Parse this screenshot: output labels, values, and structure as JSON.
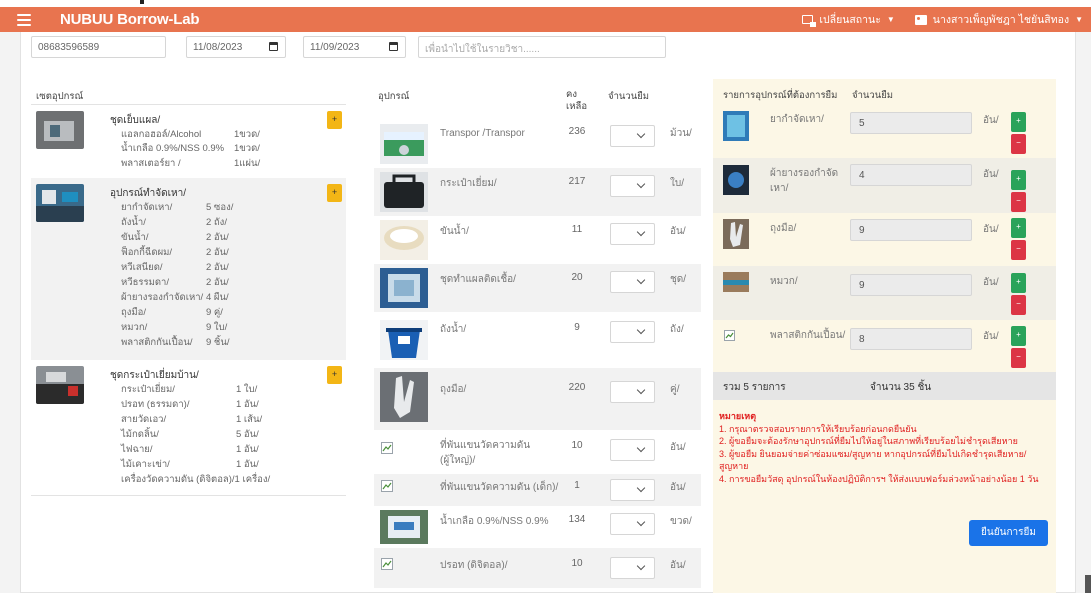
{
  "navbar": {
    "title": "NUBUU Borrow-Lab",
    "change_status_label": "เปลี่ยนสถานะ",
    "user_label": "นางสาวเพ็ญพัชฎา ไชยันสิทอง"
  },
  "filters": {
    "phone": "08683596589",
    "date_from": "11/08/2023",
    "date_to": "11/09/2023",
    "purpose_placeholder": "เพื่อนำไปใช้ในรายวิชา......"
  },
  "sets": {
    "header": "เซตอุปกรณ์",
    "add_label": "+",
    "items": [
      {
        "title": "ชุดเย็บแผล/",
        "lines": [
          {
            "name": "แอลกอฮอล์/Alcohol",
            "qty": "1ขวด/"
          },
          {
            "name": "น้ำเกลือ 0.9%/NSS 0.9%",
            "qty": "1ขวด/"
          },
          {
            "name": "พลาสเตอร์ยา /",
            "qty": "1แผ่น/"
          }
        ]
      },
      {
        "title": "อุปกรณ์ทำจัดเหา/",
        "lines": [
          {
            "name": "ยากำจัดเหา/",
            "qty": "5 ซอง/"
          },
          {
            "name": "ถังน้ำ/",
            "qty": "2 ถัง/"
          },
          {
            "name": "ขันน้ำ/",
            "qty": "2 อัน/"
          },
          {
            "name": "ฟ็อกกี้ฉีดผม/",
            "qty": "2 อัน/"
          },
          {
            "name": "หวีเสนียด/",
            "qty": "2 อัน/"
          },
          {
            "name": "หวีธรรมดา/",
            "qty": "2 อัน/"
          },
          {
            "name": "ผ้ายางรองกำจัดเหา/",
            "qty": "4 ผืน/"
          },
          {
            "name": "ถุงมือ/",
            "qty": "9 คู่/"
          },
          {
            "name": "หมวก/",
            "qty": "9 ใบ/"
          },
          {
            "name": "พลาสติกกันเปื้อน/",
            "qty": "9 ชิ้น/"
          }
        ]
      },
      {
        "title": "ชุดกระเป๋าเยี่ยมบ้าน/",
        "lines": [
          {
            "name": "กระเป๋าเยี่ยม/",
            "qty": "1 ใบ/"
          },
          {
            "name": "ปรอท (ธรรมดา)/",
            "qty": "1 อัน/"
          },
          {
            "name": "สายวัดเอว/",
            "qty": "1 เส้น/"
          },
          {
            "name": "ไม้กดลิ้น/",
            "qty": "5 อัน/"
          },
          {
            "name": "ไฟฉาย/",
            "qty": "1 อัน/"
          },
          {
            "name": "ไม้เคาะเข่า/",
            "qty": "1 อัน/"
          },
          {
            "name": "เครื่องวัดความดัน (ดิจิตอล)/",
            "qty": "1 เครื่อง/"
          }
        ]
      }
    ]
  },
  "items": {
    "header_name": "อุปกรณ์",
    "header_stock": "คง เหลือ",
    "header_qty": "จำนวนยืม",
    "rows": [
      {
        "name": "Transpor /Transpor",
        "stock": "236",
        "unit": "ม้วน/"
      },
      {
        "name": "กระเป๋าเยี่ยม/",
        "stock": "217",
        "unit": "ใบ/"
      },
      {
        "name": "ขันน้ำ/",
        "stock": "11",
        "unit": "อัน/"
      },
      {
        "name": "ชุดทำแผลติดเชื้อ/",
        "stock": "20",
        "unit": "ชุด/"
      },
      {
        "name": "ถังน้ำ/",
        "stock": "9",
        "unit": "ถัง/"
      },
      {
        "name": "ถุงมือ/",
        "stock": "220",
        "unit": "คู่/"
      },
      {
        "name": "ที่พันแขนวัดความดัน (ผู้ใหญ่)/",
        "stock": "10",
        "unit": "อัน/"
      },
      {
        "name": "ที่พันแขนวัดความดัน (เด็ก)/",
        "stock": "1",
        "unit": "อัน/"
      },
      {
        "name": "น้ำเกลือ 0.9%/NSS 0.9%",
        "stock": "134",
        "unit": "ขวด/"
      },
      {
        "name": "ปรอท (ดิจิตอล)/",
        "stock": "10",
        "unit": "อัน/"
      }
    ]
  },
  "cart": {
    "header_name": "รายการอุปกรณ์ที่ต้องการยืม",
    "header_qty": "จำนวนยืม",
    "plus_label": "+",
    "minus_label": "−",
    "rows": [
      {
        "name": "ยากำจัดเหา/",
        "qty": "5",
        "unit": "อัน/"
      },
      {
        "name": "ผ้ายางรองกำจัดเหา/",
        "qty": "4",
        "unit": "อัน/"
      },
      {
        "name": "ถุงมือ/",
        "qty": "9",
        "unit": "อัน/"
      },
      {
        "name": "หมวก/",
        "qty": "9",
        "unit": "อัน/"
      },
      {
        "name": "พลาสติกกันเปื้อน/",
        "qty": "8",
        "unit": "อัน/"
      }
    ],
    "summary_items": "รวม 5 รายการ",
    "summary_count": "จำนวน 35 ชิ้น",
    "remarks_title": "หมายเหตุ",
    "remarks": [
      "1. กรุณาตรวจสอบรายการให้เรียบร้อยก่อนกดยืนยัน",
      "2. ผู้ขอยืมจะต้องรักษาอุปกรณ์ที่ยืมไปให้อยู่ในสภาพที่เรียบร้อยไม่ชำรุดเสียหาย",
      "3. ผู้ขอยืม ยินยอมจ่ายค่าซ่อมแซม/สูญหาย หากอุปกรณ์ที่ยืมไปเกิดชำรุดเสียหาย/สูญหาย",
      "4. การขอยืมวัสดุ อุปกรณ์ในห้องปฏิบัติการฯ ให้ส่งแบบฟอร์มล่วงหน้าอย่างน้อย 1 วัน"
    ],
    "confirm_label": "ยืนยันการยืม"
  }
}
